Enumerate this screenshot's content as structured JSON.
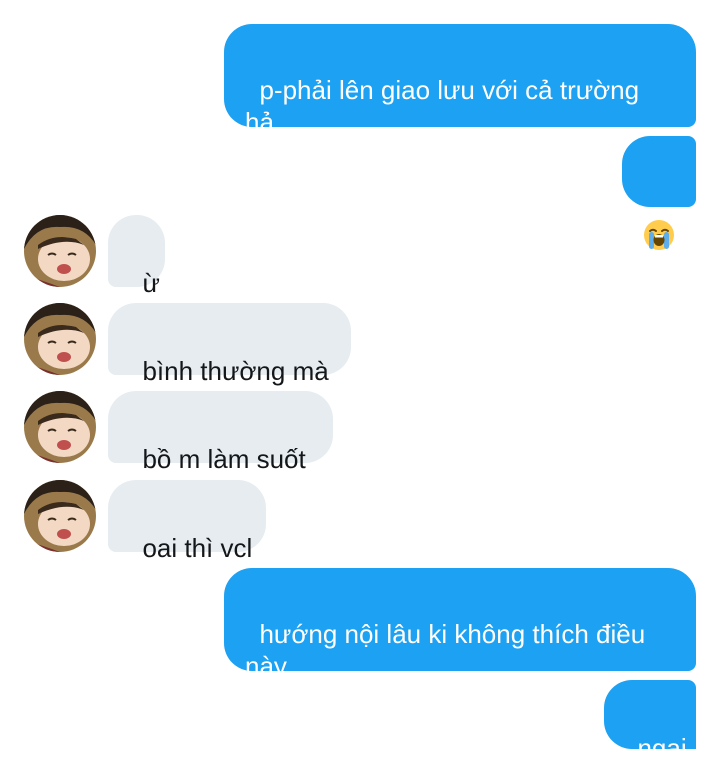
{
  "conversation": {
    "messages": [
      {
        "side": "sent",
        "text": "p-phải lên giao lưu với cả trường hả"
      },
      {
        "side": "sent",
        "text": "",
        "icon": "crying-face-emoji"
      },
      {
        "side": "received",
        "text": "ừ"
      },
      {
        "side": "received",
        "text": "bình thường mà"
      },
      {
        "side": "received",
        "text": "bồ m làm suốt"
      },
      {
        "side": "received",
        "text": "oai thì vcl"
      },
      {
        "side": "sent",
        "text": "hướng nội lâu ki không thích điều này"
      },
      {
        "side": "sent",
        "text": "ngại"
      }
    ]
  },
  "colors": {
    "sent_bubble": "#1da1f2",
    "received_bubble": "#e6ecf0",
    "sent_text": "#ffffff",
    "received_text": "#14171a"
  }
}
